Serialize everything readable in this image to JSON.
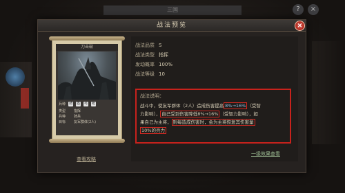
{
  "top_bar": {
    "title": "三国",
    "help_icon": "?",
    "close_icon": "×"
  },
  "dialog": {
    "title": "战法预览",
    "close_icon": "×"
  },
  "card": {
    "name": "刀击破",
    "icons_label": "兵种",
    "icon_glyphs": [
      "骑",
      "盾",
      "弓",
      "枪"
    ],
    "rows": [
      {
        "key": "类型",
        "value": "指挥"
      },
      {
        "key": "兵种",
        "value": "骑兵"
      },
      {
        "key": "目标",
        "value": "友军群体(2人)"
      }
    ]
  },
  "strategy_link": "查看攻略",
  "info": {
    "rows": [
      {
        "key": "战法品质",
        "value": "S"
      },
      {
        "key": "战法类型",
        "value": "指挥"
      },
      {
        "key": "发动概率",
        "value": "100%"
      },
      {
        "key": "战法等级",
        "value": "10"
      }
    ],
    "desc_title": "战法说明：",
    "desc_line1_a": "战斗中，使友军群体（2人）造成伤害提高",
    "desc_line1_hl": "8%→16%",
    "desc_line1_b": "（受智",
    "desc_line2_a": "力影响），",
    "desc_line2_hl": "自己受到伤害降低8%→16%",
    "desc_line2_b": "（受智力影响），如",
    "desc_line3_a": "果自己为主将，",
    "desc_line3_hl": "则每造成伤害时，会为主将恢复其伤害量",
    "desc_line4_hl": "10%的兵力",
    "preview_link": "一级效果查看"
  }
}
